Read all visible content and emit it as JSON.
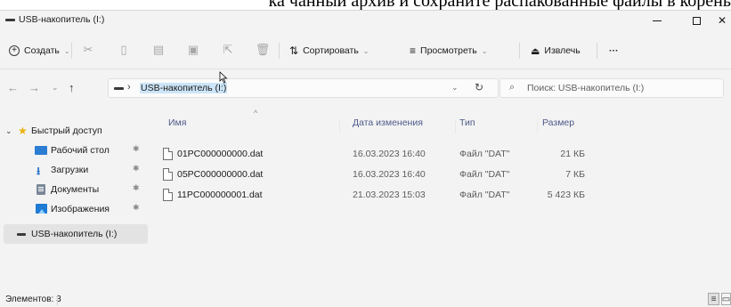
{
  "document_text": "ка чанный архив и сохраните распакованные файлы в корень",
  "window": {
    "title": "USB-накопитель (I:)",
    "minimize_glyph": "—",
    "close_glyph": "✕"
  },
  "toolbar": {
    "create_label": "Создать",
    "sort_label": "Сортировать",
    "view_label": "Просмотреть",
    "eject_label": "Извлечь",
    "more_label": "···",
    "dropdown_glyph": "⌄"
  },
  "navigation": {
    "back_glyph": "←",
    "forward_glyph": "→",
    "recent_glyph": "⌄",
    "up_glyph": "↑",
    "path_separator": "›",
    "current_path": "USB-накопитель (I:)",
    "history_glyph": "⌄",
    "refresh_glyph": "↻",
    "search_placeholder": "Поиск: USB-накопитель (I:)"
  },
  "sidebar": {
    "items": [
      {
        "label": "Быстрый доступ",
        "icon": "star-icon",
        "expander": "⌄"
      },
      {
        "label": "Рабочий стол",
        "icon": "desktop-icon",
        "pinned": true
      },
      {
        "label": "Загрузки",
        "icon": "downloads-icon",
        "pinned": true
      },
      {
        "label": "Документы",
        "icon": "documents-icon",
        "pinned": true
      },
      {
        "label": "Изображения",
        "icon": "pictures-icon",
        "pinned": true
      },
      {
        "label": "USB-накопитель (I:)",
        "icon": "usb-drive-icon",
        "selected": true
      }
    ],
    "pin_glyph": "✱"
  },
  "file_list": {
    "columns": {
      "name": "Имя",
      "date": "Дата изменения",
      "type": "Тип",
      "size": "Размер"
    },
    "sort_glyph": "^",
    "rows": [
      {
        "name": "01PC000000000.dat",
        "date": "16.03.2023 16:40",
        "type": "Файл \"DAT\"",
        "size": "21 КБ"
      },
      {
        "name": "05PC000000000.dat",
        "date": "16.03.2023 16:40",
        "type": "Файл \"DAT\"",
        "size": "7 КБ"
      },
      {
        "name": "11PC000000001.dat",
        "date": "21.03.2023 15:03",
        "type": "Файл \"DAT\"",
        "size": "5 423 КБ"
      }
    ]
  },
  "status_bar": {
    "item_count": "Элементов: 3",
    "details_view_glyph": "≡",
    "tiles_view_glyph": "▭"
  },
  "colors": {
    "accent": "#0067c0",
    "selection": "#cce4f7",
    "window_bg": "#f3f3f3"
  }
}
